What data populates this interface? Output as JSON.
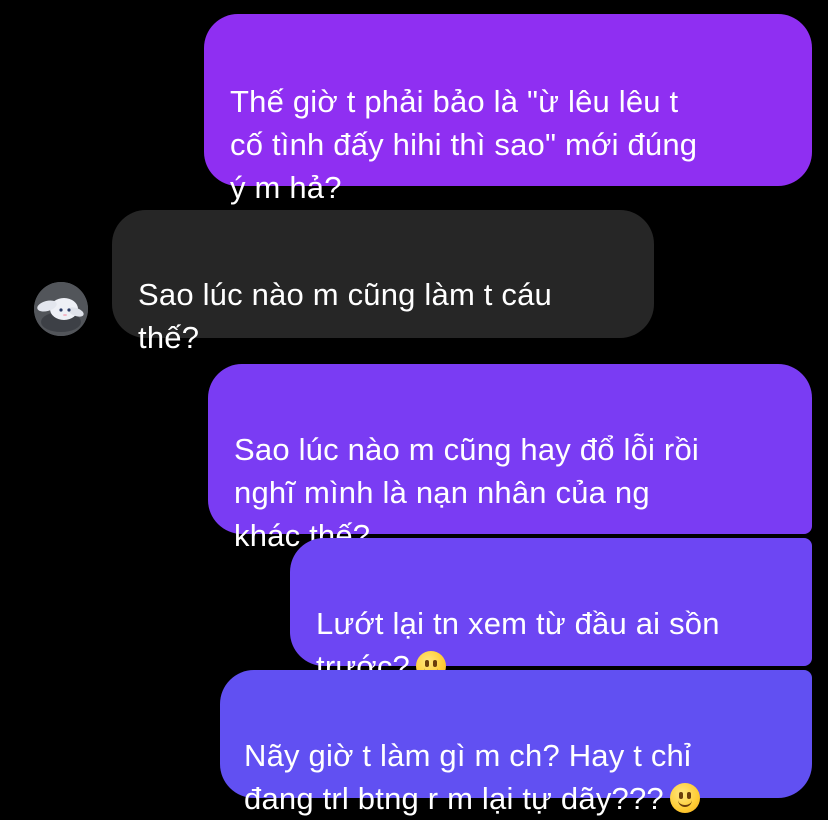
{
  "colors": {
    "background": "#000000",
    "outgoing_bubble": "#7d3cf2",
    "incoming_bubble": "#262626",
    "text": "#ffffff"
  },
  "messages": [
    {
      "sender": "me",
      "text": "Thế giờ t phải bảo là \"ừ lêu lêu t\ncố tình đấy hihi thì sao\" mới đúng\ný m hả?"
    },
    {
      "sender": "other",
      "text": "Sao lúc nào m cũng làm t cáu\nthế?"
    },
    {
      "sender": "me",
      "text": "Sao lúc nào m cũng hay đổ lỗi rồi\nnghĩ mình là nạn nhân của ng\nkhác thế?"
    },
    {
      "sender": "me",
      "text": "Lướt lại tn xem từ đầu ai sồn\ntrước?",
      "emoji": "slightly-smiling-face"
    },
    {
      "sender": "me",
      "text": "Nãy giờ t làm gì m ch? Hay t chỉ\nđang trl btng r m lại tự dãy???",
      "emoji": "slightly-smiling-face"
    }
  ],
  "avatar": {
    "icon": "cinnamoroll-avatar-icon"
  }
}
